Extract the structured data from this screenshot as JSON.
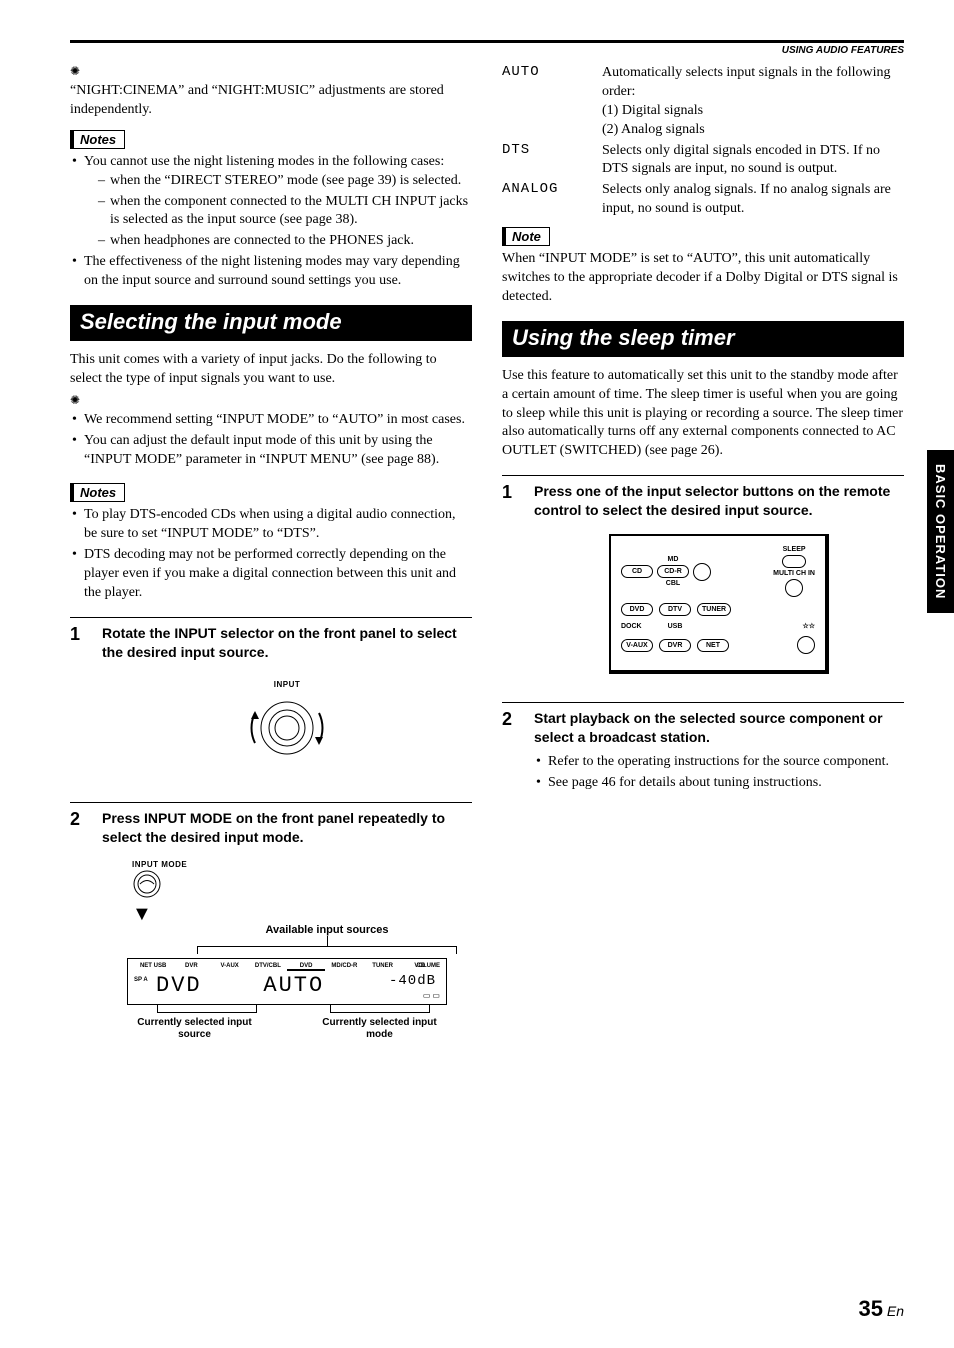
{
  "header": {
    "section_label": "USING AUDIO FEATURES"
  },
  "side_tab": "BASIC OPERATION",
  "page": {
    "number": "35",
    "suffix": "En"
  },
  "left": {
    "tip1": "“NIGHT:CINEMA” and “NIGHT:MUSIC” adjustments are stored independently.",
    "notes1_label": "Notes",
    "notes1_b1": "You cannot use the night listening modes in the following cases:",
    "notes1_d1": "when the “DIRECT STEREO” mode (see page 39) is selected.",
    "notes1_d2": "when the component connected to the MULTI CH INPUT jacks is selected as the input source (see page 38).",
    "notes1_d3": "when headphones are connected to the PHONES jack.",
    "notes1_b2": "The effectiveness of the night listening modes may vary depending on the input source and surround sound settings you use.",
    "section1_title": "Selecting the input mode",
    "intro1": "This unit comes with a variety of input jacks. Do the following to select the type of input signals you want to use.",
    "tips2_b1": "We recommend setting “INPUT MODE” to “AUTO” in most cases.",
    "tips2_b2": "You can adjust the default input mode of this unit by using the “INPUT MODE” parameter in “INPUT MENU” (see page 88).",
    "notes2_label": "Notes",
    "notes2_b1": "To play DTS-encoded CDs when using a digital audio connection, be sure to set “INPUT MODE” to “DTS”.",
    "notes2_b2": "DTS decoding may not be performed correctly depending on the player even if you make a digital connection between this unit and the player.",
    "step1_num": "1",
    "step1_title": "Rotate the INPUT selector on the front panel to select the desired input source.",
    "dial_label": "INPUT",
    "step2_num": "2",
    "step2_title": "Press INPUT MODE on the front panel repeatedly to select the desired input mode.",
    "btn_label": "INPUT MODE",
    "avail_label": "Available input sources",
    "panel_sources": [
      "NET USB",
      "DVR",
      "V-AUX",
      "DTV/CBL",
      "DVD",
      "MD/CD-R",
      "TUNER",
      "CD"
    ],
    "panel_sp": "SP A",
    "panel_vol_label": "VOLUME",
    "panel_src_val": "DVD",
    "panel_mode_val": "AUTO",
    "panel_vol_val": "-40dB",
    "cur_src": "Currently selected input source",
    "cur_mode": "Currently selected input mode"
  },
  "right": {
    "modes": {
      "auto_key": "AUTO",
      "auto_desc": "Automatically selects input signals in the following order:\n(1) Digital signals\n(2) Analog signals",
      "dts_key": "DTS",
      "dts_desc": "Selects only digital signals encoded in DTS. If no DTS signals are input, no sound is output.",
      "analog_key": "ANALOG",
      "analog_desc": "Selects only analog signals. If no analog signals are input, no sound is output."
    },
    "note_label": "Note",
    "note_text": "When “INPUT MODE” is set to “AUTO”, this unit automatically switches to the appropriate decoder if a Dolby Digital or DTS signal is detected.",
    "section2_title": "Using the sleep timer",
    "intro2": "Use this feature to automatically set this unit to the standby mode after a certain amount of time. The sleep timer is useful when you are going to sleep while this unit is playing or recording a source. The sleep timer also automatically turns off any external components connected to AC OUTLET (SWITCHED) (see page 26).",
    "step1_num": "1",
    "step1_title": "Press one of the input selector buttons on the remote control to select the desired input source.",
    "remote": {
      "md": "MD",
      "cd": "CD",
      "cdr": "CD-R",
      "cbl": "CBL",
      "dvd": "DVD",
      "dtv": "DTV",
      "tuner": "TUNER",
      "dock": "DOCK",
      "usb": "USB",
      "vaux": "V-AUX",
      "dvr": "DVR",
      "net": "NET",
      "sleep": "SLEEP",
      "multi": "MULTI CH IN",
      "title": "☆☆"
    },
    "step2_num": "2",
    "step2_title": "Start playback on the selected source component or select a broadcast station.",
    "step2_b1": "Refer to the operating instructions for the source component.",
    "step2_b2": "See page 46 for details about tuning instructions."
  }
}
